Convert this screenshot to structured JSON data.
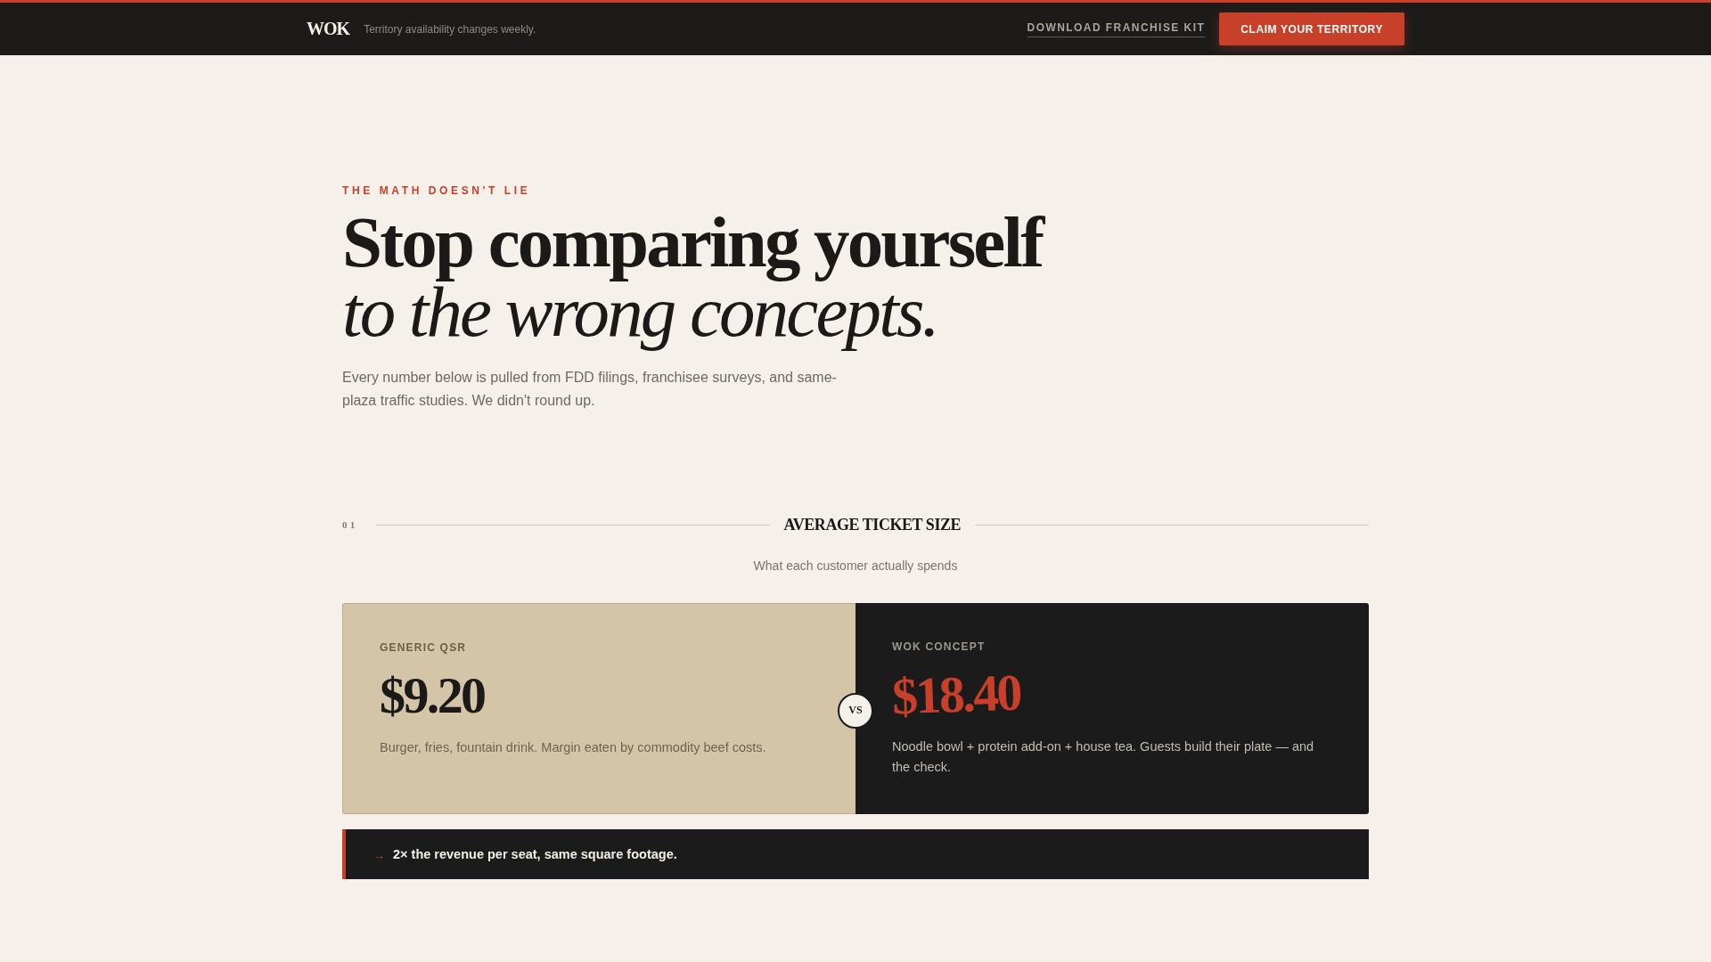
{
  "header": {
    "logo": "WOK",
    "tagline": "Territory availability changes weekly.",
    "link": "DOWNLOAD FRANCHISE KIT",
    "cta": "CLAIM YOUR TERRITORY"
  },
  "hero": {
    "eyebrow": "THE MATH DOESN'T LIE",
    "headline": [
      {
        "kind": "bold",
        "text": "Stop comparing yourself"
      },
      {
        "kind": "italic",
        "text": "to the wrong concepts."
      }
    ],
    "intro": "Every number below is pulled from FDD filings, franchisee surveys, and same-plaza traffic studies. We didn't round up."
  },
  "sections": [
    {
      "number": "01",
      "title": "AVERAGE TICKET SIZE",
      "subtitle": "What each customer actually spends",
      "cards": [
        {
          "kind": "baseline",
          "label": "GENERIC QSR",
          "price": "$9.20",
          "description": "Burger, fries, fountain drink. Margin eaten by commodity beef costs."
        },
        {
          "kind": "featured",
          "label": "WOK CONCEPT",
          "price": "$18.40",
          "description": "Noodle bowl + protein add-on + house tea. Guests build their plate — and the check."
        }
      ],
      "versus": "VS",
      "callout": {
        "marker": "→",
        "text": "2× the revenue per seat, same square footage."
      }
    }
  ]
}
